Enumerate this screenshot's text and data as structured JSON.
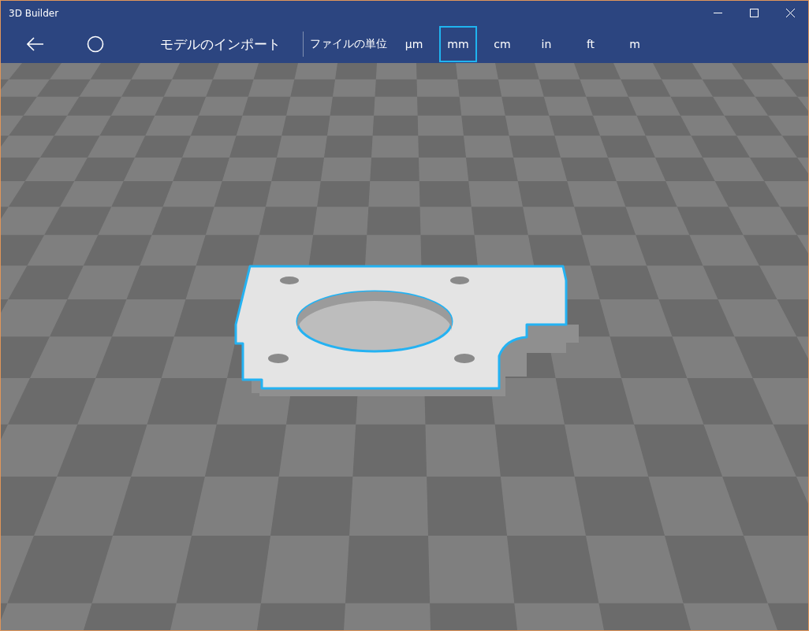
{
  "window": {
    "title": "3D Builder"
  },
  "toolbar": {
    "import_button": "モデルのインポート",
    "units_label": "ファイルの単位",
    "units": [
      {
        "label": "μm",
        "selected": false
      },
      {
        "label": "mm",
        "selected": true
      },
      {
        "label": "cm",
        "selected": false
      },
      {
        "label": "in",
        "selected": false
      },
      {
        "label": "ft",
        "selected": false
      },
      {
        "label": "m",
        "selected": false
      }
    ]
  }
}
